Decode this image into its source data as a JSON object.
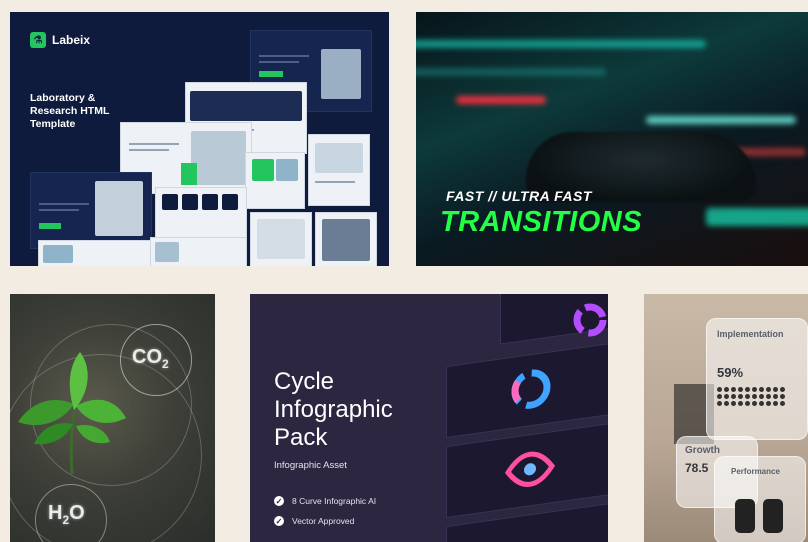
{
  "tiles": {
    "labeix": {
      "brand": "Labeix",
      "title": "Laboratory & Research HTML Template"
    },
    "transitions": {
      "tagline": "FAST // ULTRA FAST",
      "headline": "TRANSITIONS"
    },
    "co2": {
      "molecule_top": "CO",
      "molecule_top_sub": "2",
      "molecule_bottom": "H",
      "molecule_bottom_sub": "2",
      "molecule_bottom_tail": "O"
    },
    "cycle": {
      "title_line1": "Cycle",
      "title_line2": "Infographic",
      "title_line3": "Pack",
      "subtitle": "Infographic Asset",
      "features": [
        "8 Curve Infographic AI",
        "Vector Approved"
      ]
    },
    "performance": {
      "card1_label": "Implementation",
      "card1_value": "59%",
      "card2_label": "Growth",
      "card2_value": "78.5",
      "card3_label": "Performance"
    }
  },
  "colors": {
    "page_bg": "#f3ece3",
    "labeix_bg": "#0f1b3d",
    "accent_green": "#22c55e",
    "transitions_green": "#22ff45",
    "cycle_bg": "#2c2640"
  }
}
